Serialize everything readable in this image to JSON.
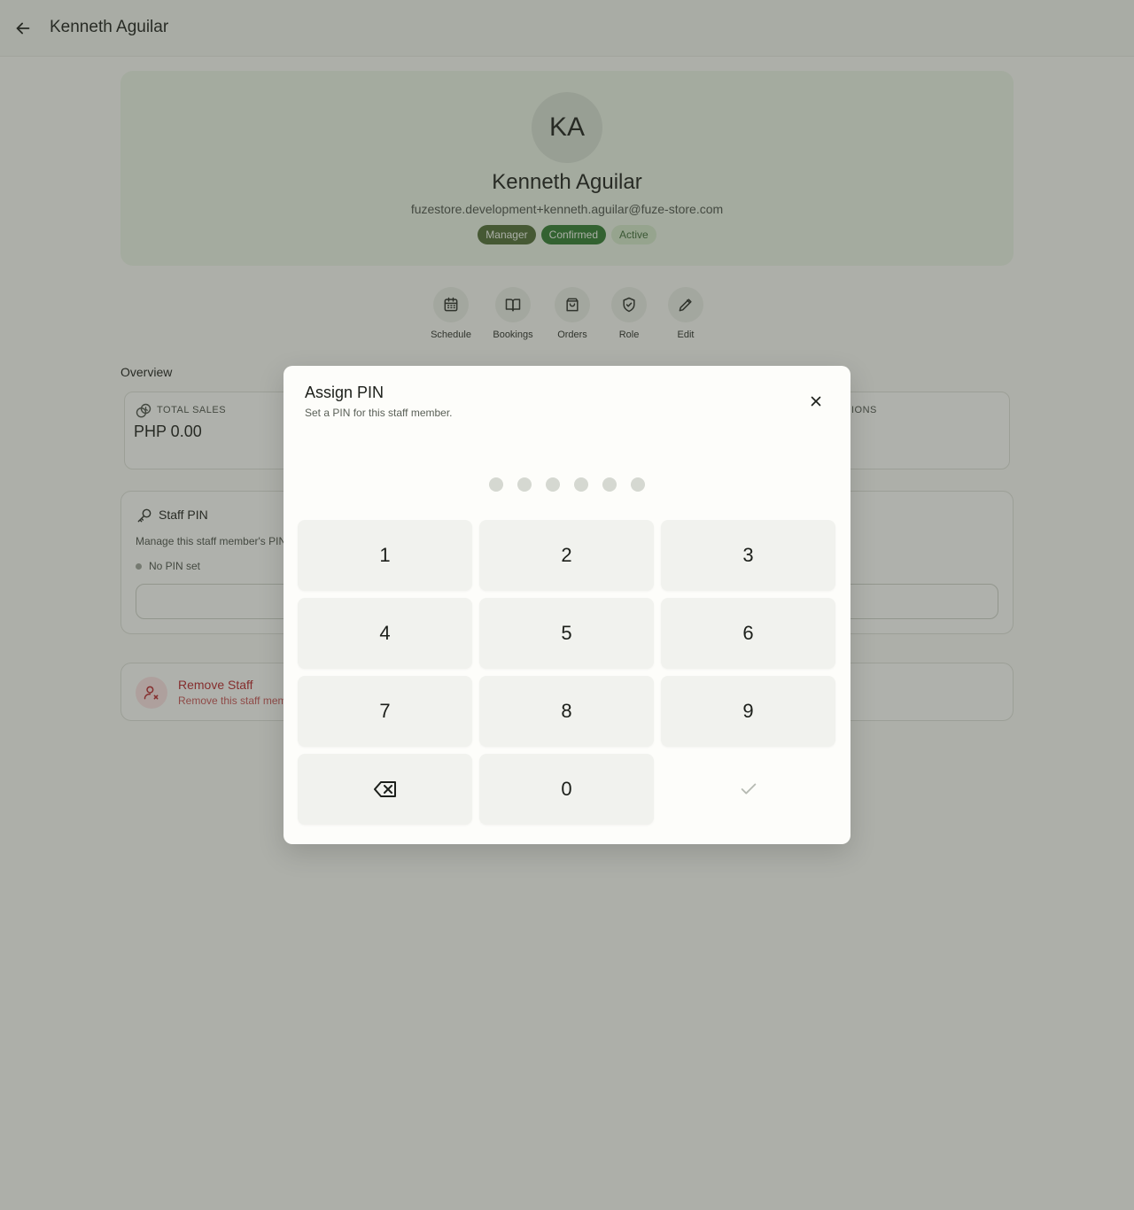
{
  "header": {
    "title": "Kenneth Aguilar",
    "back_icon": "arrow-left-icon"
  },
  "profile": {
    "initials": "KA",
    "name": "Kenneth Aguilar",
    "email": "fuzestore.development+kenneth.aguilar@fuze-store.com",
    "badges": [
      "Manager",
      "Confirmed",
      "Active"
    ]
  },
  "actions": [
    {
      "label": "Schedule",
      "icon": "calendar-icon"
    },
    {
      "label": "Bookings",
      "icon": "book-open-icon"
    },
    {
      "label": "Orders",
      "icon": "shopping-bag-icon"
    },
    {
      "label": "Role",
      "icon": "shield-check-icon"
    },
    {
      "label": "Edit",
      "icon": "pencil-icon"
    }
  ],
  "overview": {
    "title": "Overview",
    "total_sales_label": "TOTAL SALES",
    "total_sales_value": "PHP 0.00",
    "right_label_fragment": "IONS"
  },
  "staff_pin": {
    "title": "Staff PIN",
    "description": "Manage this staff member's PIN",
    "status": "No PIN set"
  },
  "remove_staff": {
    "title": "Remove Staff",
    "description": "Remove this staff member"
  },
  "modal": {
    "title": "Assign PIN",
    "subtitle": "Set a PIN for this staff member.",
    "pin_length": 6,
    "keys": [
      "1",
      "2",
      "3",
      "4",
      "5",
      "6",
      "7",
      "8",
      "9",
      "backspace",
      "0",
      "confirm"
    ]
  },
  "colors": {
    "accent_dark": "#4e6b35",
    "confirmed": "#2f7a2f",
    "danger": "#b3262a"
  }
}
